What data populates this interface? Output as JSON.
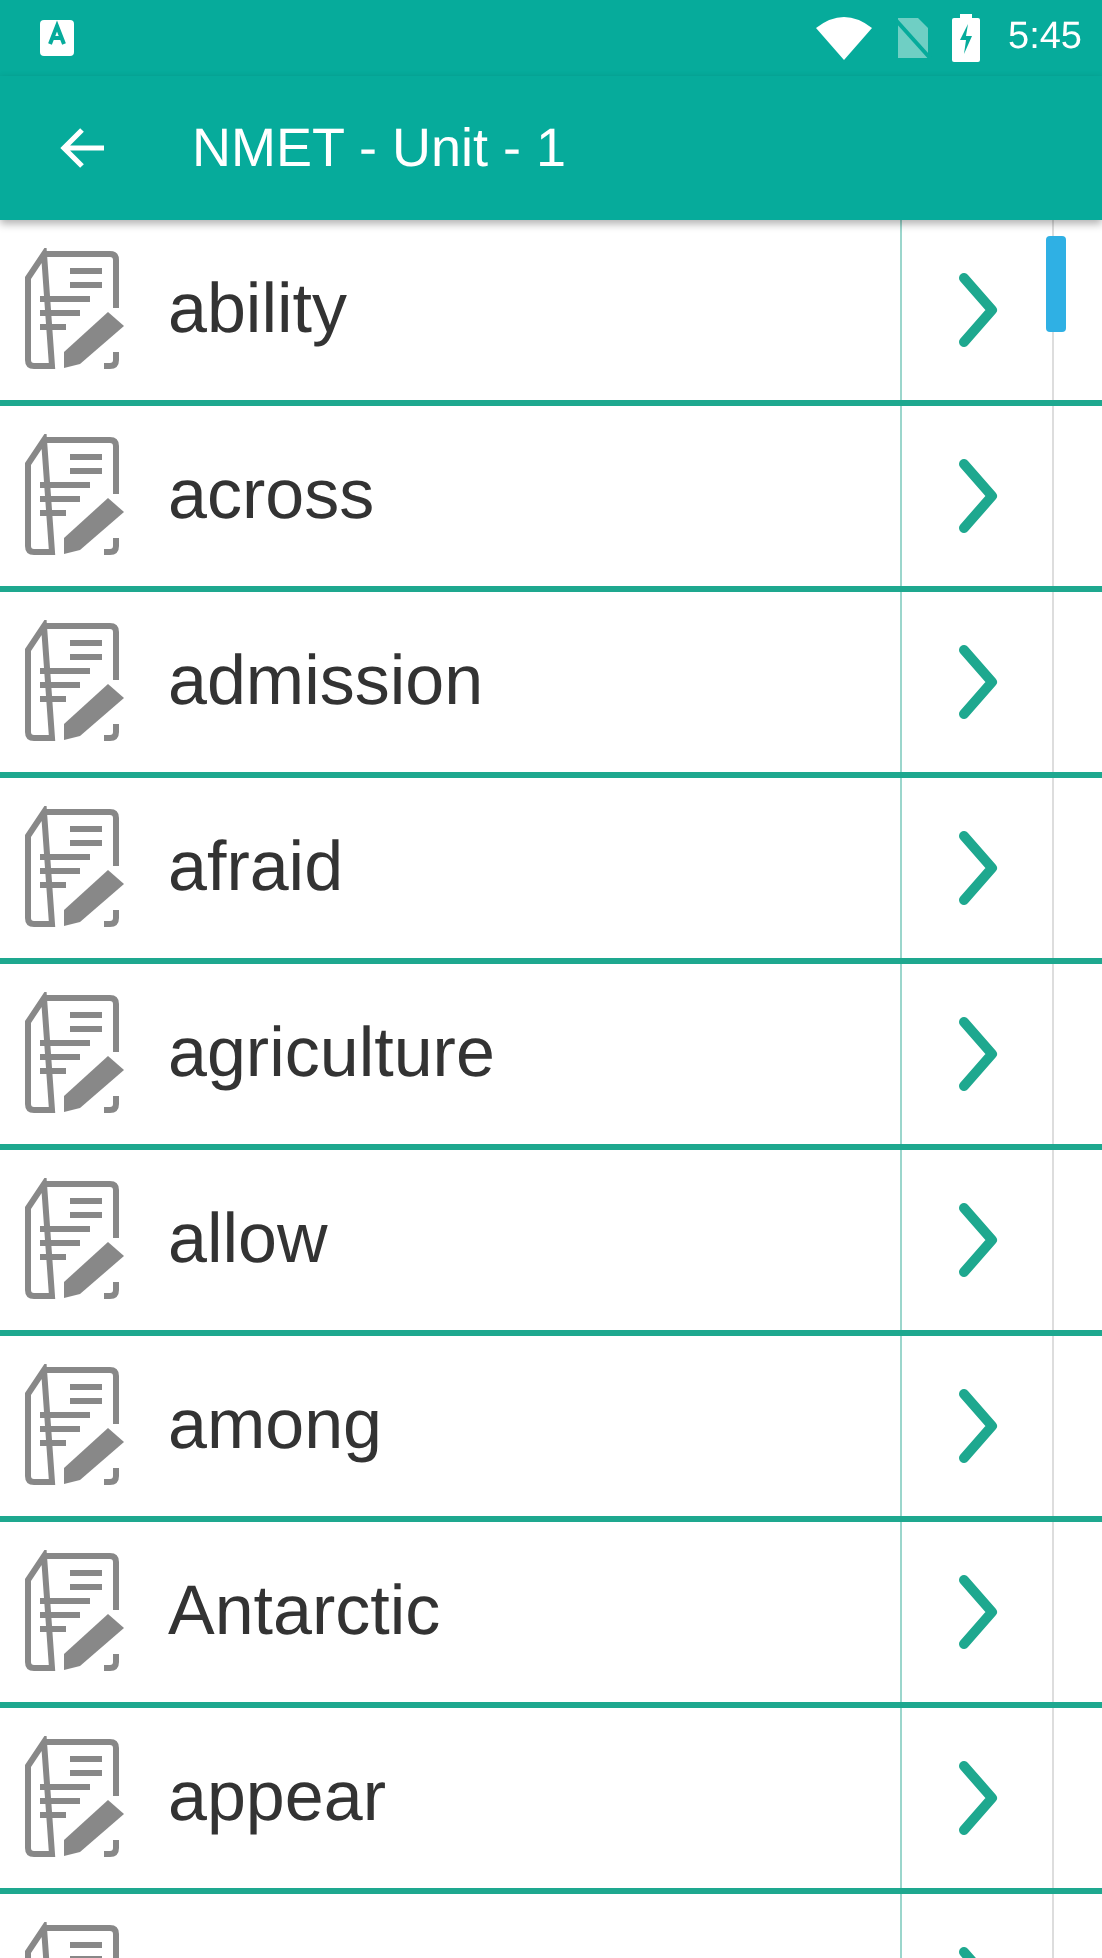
{
  "status_bar": {
    "time": "5:45"
  },
  "toolbar": {
    "title": "NMET - Unit - 1"
  },
  "words": [
    "ability",
    "across",
    "admission",
    "afraid",
    "agriculture",
    "allow",
    "among",
    "Antarctic",
    "appear"
  ]
}
